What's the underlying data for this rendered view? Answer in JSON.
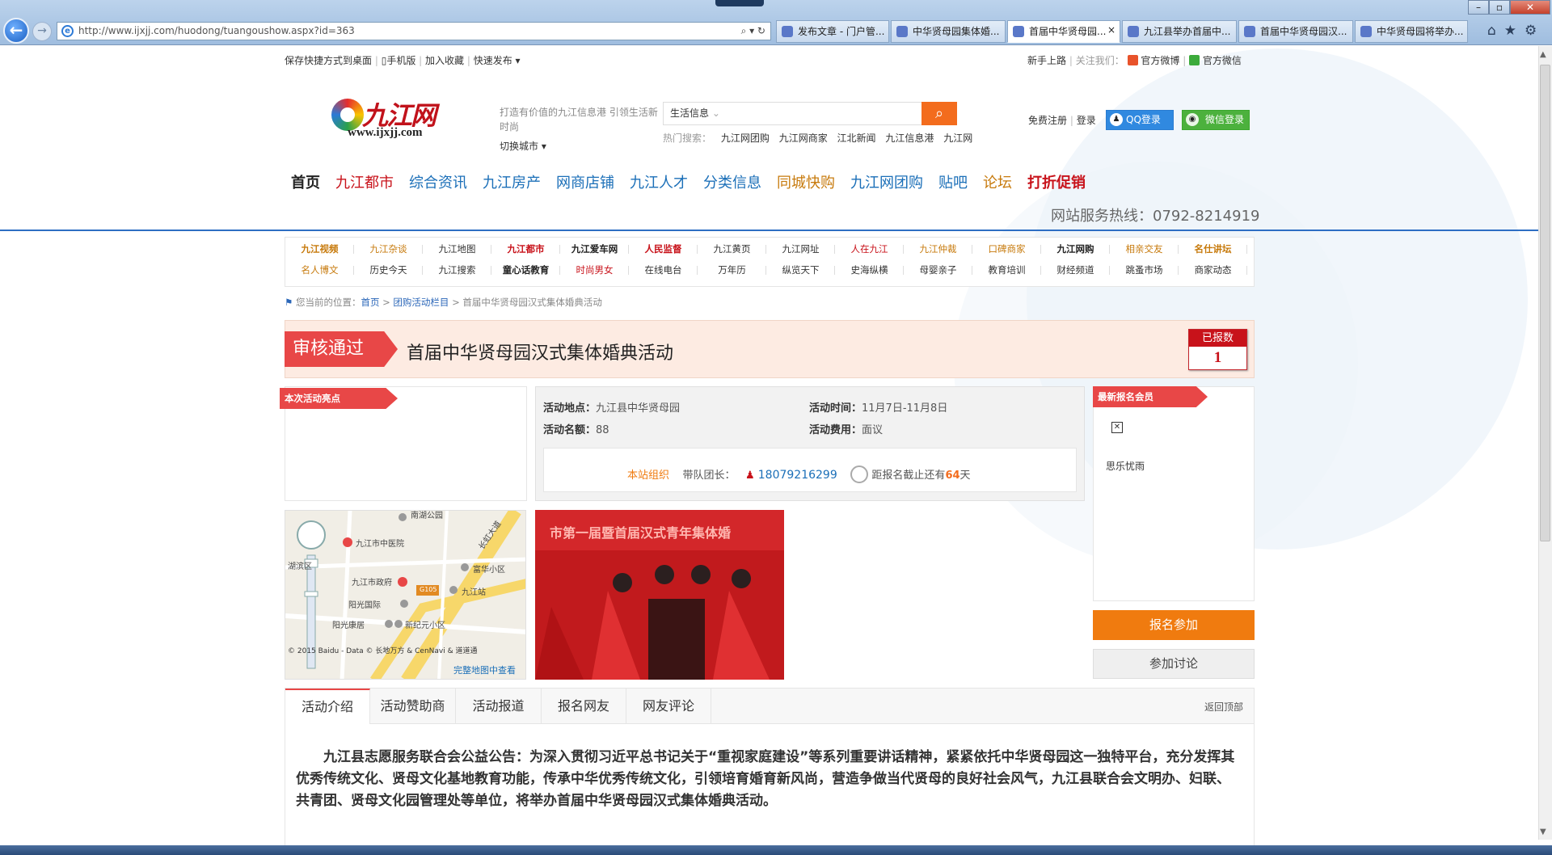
{
  "browser": {
    "url": "http://www.ijxjj.com/huodong/tuangoushow.aspx?id=363",
    "tabs": [
      "发布文章 - 门户管...",
      "中华贤母园集体婚...",
      "首届中华贤母园...",
      "九江县举办首届中...",
      "首届中华贤母园汉...",
      "中华贤母园将举办..."
    ],
    "active_tab": 2,
    "tab_close": "×"
  },
  "toplinks": {
    "left": [
      "保存快捷方式到桌面",
      "手机版",
      "加入收藏",
      "快速发布"
    ],
    "right_newbie": "新手上路",
    "follow_us": "关注我们：",
    "weibo": "官方微博",
    "weixin": "官方微信"
  },
  "logo": {
    "cn": "九江网",
    "en": "www.ijxjj.com"
  },
  "header": {
    "slogan": "打造有价值的九江信息港 引领生活新时尚",
    "switch_city": "切换城市",
    "search_placeholder": "生活信息",
    "search_icon": "🔍",
    "hot_label": "热门搜索：",
    "hot": [
      "九江网团购",
      "九江网商家",
      "江北新闻",
      "九江信息港",
      "九江网"
    ],
    "register": "免费注册",
    "login": "登录",
    "qq_login": "QQ登录",
    "wx_login": "微信登录"
  },
  "mainnav": [
    {
      "label": "首页",
      "color": "#222222"
    },
    {
      "label": "九江都市",
      "color": "#c8121a"
    },
    {
      "label": "综合资讯",
      "color": "#1b6fb8"
    },
    {
      "label": "九江房产",
      "color": "#1b6fb8"
    },
    {
      "label": "网商店铺",
      "color": "#1b6fb8"
    },
    {
      "label": "九江人才",
      "color": "#1b6fb8"
    },
    {
      "label": "分类信息",
      "color": "#1b6fb8"
    },
    {
      "label": "同城快购",
      "color": "#c77a0c"
    },
    {
      "label": "九江网团购",
      "color": "#1b6fb8"
    },
    {
      "label": "贴吧",
      "color": "#1b6fb8"
    },
    {
      "label": "论坛",
      "color": "#c77a0c"
    },
    {
      "label": "打折促销",
      "color": "#c8121a"
    }
  ],
  "hotline": "网站服务热线：0792-8214919",
  "subnav": {
    "row1": [
      {
        "label": "九江视频",
        "color": "#c77a0c",
        "bold": true
      },
      {
        "label": "九江杂谈",
        "color": "#c77a0c",
        "bold": false
      },
      {
        "label": "九江地图",
        "color": "#333333",
        "bold": false
      },
      {
        "label": "九江都市",
        "color": "#c8121a",
        "bold": true
      },
      {
        "label": "九江爱车网",
        "color": "#222222",
        "bold": true
      },
      {
        "label": "人民监督",
        "color": "#c8121a",
        "bold": true
      },
      {
        "label": "九江黄页",
        "color": "#333333",
        "bold": false
      },
      {
        "label": "九江网址",
        "color": "#333333",
        "bold": false
      },
      {
        "label": "人在九江",
        "color": "#c8121a",
        "bold": false
      },
      {
        "label": "九江仲裁",
        "color": "#c77a0c",
        "bold": false
      },
      {
        "label": "口碑商家",
        "color": "#c77a0c",
        "bold": false
      },
      {
        "label": "九江网购",
        "color": "#222222",
        "bold": true
      },
      {
        "label": "相亲交友",
        "color": "#c77a0c",
        "bold": false
      },
      {
        "label": "名仕讲坛",
        "color": "#c77a0c",
        "bold": true
      }
    ],
    "row2": [
      {
        "label": "名人博文",
        "color": "#c77a0c",
        "bold": false
      },
      {
        "label": "历史今天",
        "color": "#333333",
        "bold": false
      },
      {
        "label": "九江搜索",
        "color": "#333333",
        "bold": false
      },
      {
        "label": "童心话教育",
        "color": "#222222",
        "bold": true
      },
      {
        "label": "时尚男女",
        "color": "#c8121a",
        "bold": false
      },
      {
        "label": "在线电台",
        "color": "#333333",
        "bold": false
      },
      {
        "label": "万年历",
        "color": "#333333",
        "bold": false
      },
      {
        "label": "纵览天下",
        "color": "#333333",
        "bold": false
      },
      {
        "label": "史海纵横",
        "color": "#333333",
        "bold": false
      },
      {
        "label": "母婴亲子",
        "color": "#333333",
        "bold": false
      },
      {
        "label": "教育培训",
        "color": "#333333",
        "bold": false
      },
      {
        "label": "财经频道",
        "color": "#333333",
        "bold": false
      },
      {
        "label": "跳蚤市场",
        "color": "#333333",
        "bold": false
      },
      {
        "label": "商家动态",
        "color": "#333333",
        "bold": false
      }
    ]
  },
  "breadcrumb": {
    "prefix": "您当前的位置：",
    "home": "首页",
    "section": "团购活动栏目",
    "current": "首届中华贤母园汉式集体婚典活动",
    "sep": ">"
  },
  "event": {
    "status": "审核通过",
    "title": "首届中华贤母园汉式集体婚典活动",
    "registered_label": "已报数",
    "registered_count": "1",
    "highlights_label": "本次活动亮点",
    "location_label": "活动地点：",
    "location": "九江县中华贤母园",
    "time_label": "活动时间：",
    "time": "11月7日-11月8日",
    "quota_label": "活动名额：",
    "quota": "88",
    "fee_label": "活动费用：",
    "fee": "面议",
    "organizer": "本站组织",
    "leader_label": "带队团长：",
    "leader_phone": "18079216299",
    "deadline_prefix": "距报名截止还有",
    "deadline_days": "64",
    "deadline_suffix": "天"
  },
  "map": {
    "labels": [
      "南湖公园",
      "九江市中医院",
      "长虹大道",
      "湖滨区",
      "富华小区",
      "九江市政府",
      "九江站",
      "阳光国际",
      "阳光康居",
      "新纪元小区",
      "G105"
    ],
    "copyright": "© 2015 Baidu - Data © 长地万方 & CenNavi & 道道通",
    "full_map_link": "完整地图中查看"
  },
  "photo": {
    "banner_text": "市第一届暨首届汉式青年集体婚"
  },
  "members": {
    "label": "最新报名会员",
    "names": [
      "思乐忧雨"
    ]
  },
  "actions": {
    "join": "报名参加",
    "discuss": "参加讨论"
  },
  "content_tabs": [
    "活动介绍",
    "活动赞助商",
    "活动报道",
    "报名网友",
    "网友评论"
  ],
  "back_top": "返回顶部",
  "intro": "九江县志愿服务联合会公益公告：为深入贯彻习近平总书记关于“重视家庭建设”等系列重要讲话精神，紧紧依托中华贤母园这一独特平台，充分发挥其优秀传统文化、贤母文化基地教育功能，传承中华优秀传统文化，引领培育婚育新风尚，营造争做当代贤母的良好社会风气，九江县联合会文明办、妇联、共青团、贤母文化园管理处等单位，将举办首届中华贤母园汉式集体婚典活动。"
}
